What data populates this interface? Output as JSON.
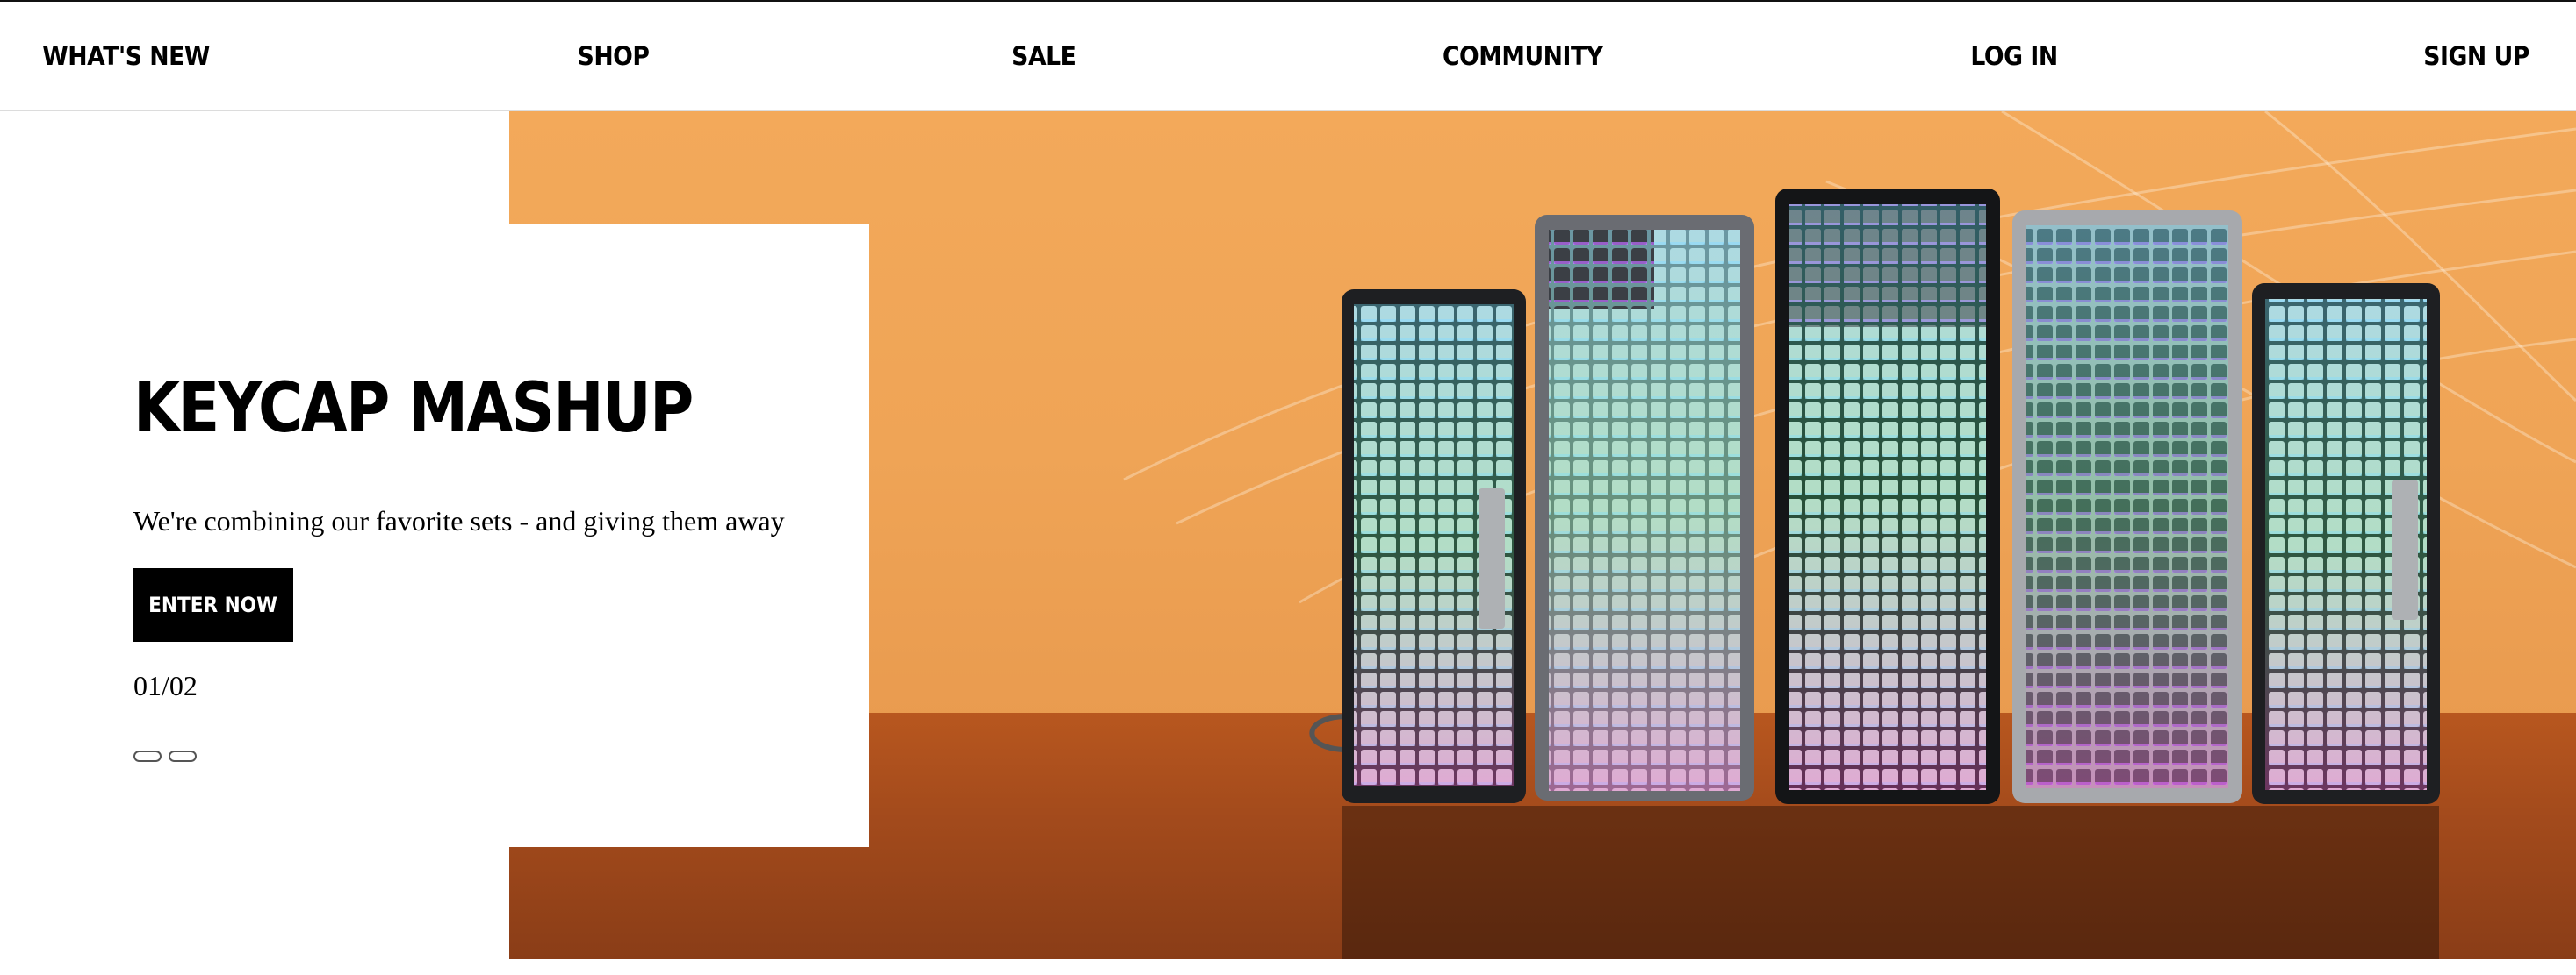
{
  "nav": {
    "whats_new": "WHAT'S NEW",
    "shop": "SHOP",
    "sale": "SALE",
    "community": "COMMUNITY",
    "log_in": "LOG IN",
    "sign_up": "SIGN UP"
  },
  "promo": {
    "title": "KEYCAP MASHUP",
    "subtitle": "We're combining our favorite sets - and giving them away",
    "cta_label": "ENTER NOW",
    "slide_counter": "01/02",
    "slide_dots": 2
  },
  "hero": {
    "image": "five-backlit-keyboards-on-orange-backdrop",
    "colors": {
      "backdrop": "#f3a95a",
      "floor": "#a44b1c"
    }
  }
}
